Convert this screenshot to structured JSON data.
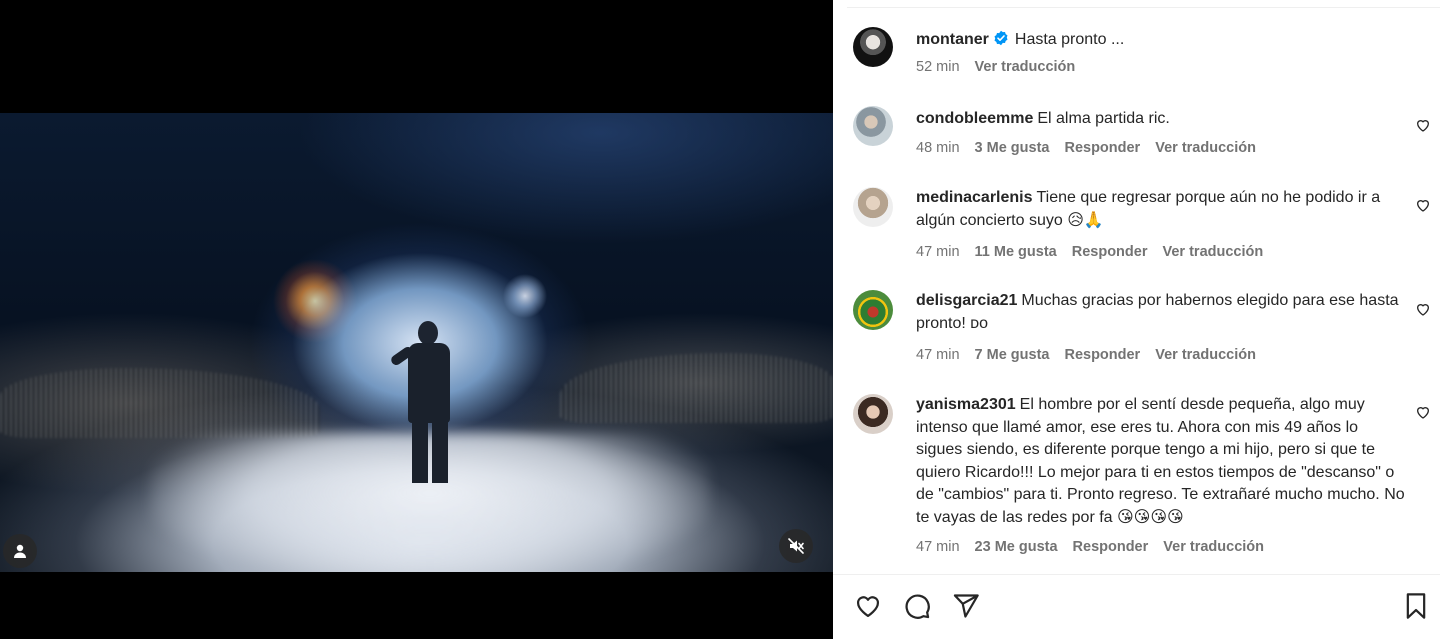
{
  "post": {
    "username": "montaner",
    "caption": "Hasta pronto ...",
    "time": "52 min",
    "translate": "Ver traducción"
  },
  "comments": [
    {
      "username": "condobleemme",
      "text": "El alma partida ric.",
      "time": "48 min",
      "likes": "3 Me gusta",
      "reply": "Responder",
      "translate": "Ver traducción"
    },
    {
      "username": "medinacarlenis",
      "text": "Tiene que regresar porque aún no he podido ir a algún concierto suyo 😥🙏",
      "time": "47 min",
      "likes": "11 Me gusta",
      "reply": "Responder",
      "translate": "Ver traducción"
    },
    {
      "username": "delisgarcia21",
      "text": "Muchas gracias por habernos elegido para ese hasta pronto! ᴅo",
      "time": "47 min",
      "likes": "7 Me gusta",
      "reply": "Responder",
      "translate": "Ver traducción"
    },
    {
      "username": "yanisma2301",
      "text": "El hombre por el sentí desde pequeña, algo muy intenso que llamé amor, ese eres tu. Ahora con mis 49 años lo sigues siendo, es diferente porque tengo a mi hijo, pero si que te quiero Ricardo!!! Lo mejor para ti en estos tiempos de \"descanso\" o de \"cambios\" para ti. Pronto regreso. Te extrañaré mucho mucho. No te vayas de las redes por fa 😘😘😘😘",
      "time": "47 min",
      "likes": "23 Me gusta",
      "reply": "Responder",
      "translate": "Ver traducción"
    }
  ],
  "icons": {
    "tag": "user-tag-icon",
    "mute": "sound-off-icon",
    "like": "heart-icon",
    "comment": "comment-icon",
    "share": "send-icon",
    "save": "bookmark-icon",
    "verified": "verified-badge-icon"
  },
  "colors": {
    "verified": "#0095f6",
    "muted_text": "#737373",
    "text": "#262626"
  }
}
